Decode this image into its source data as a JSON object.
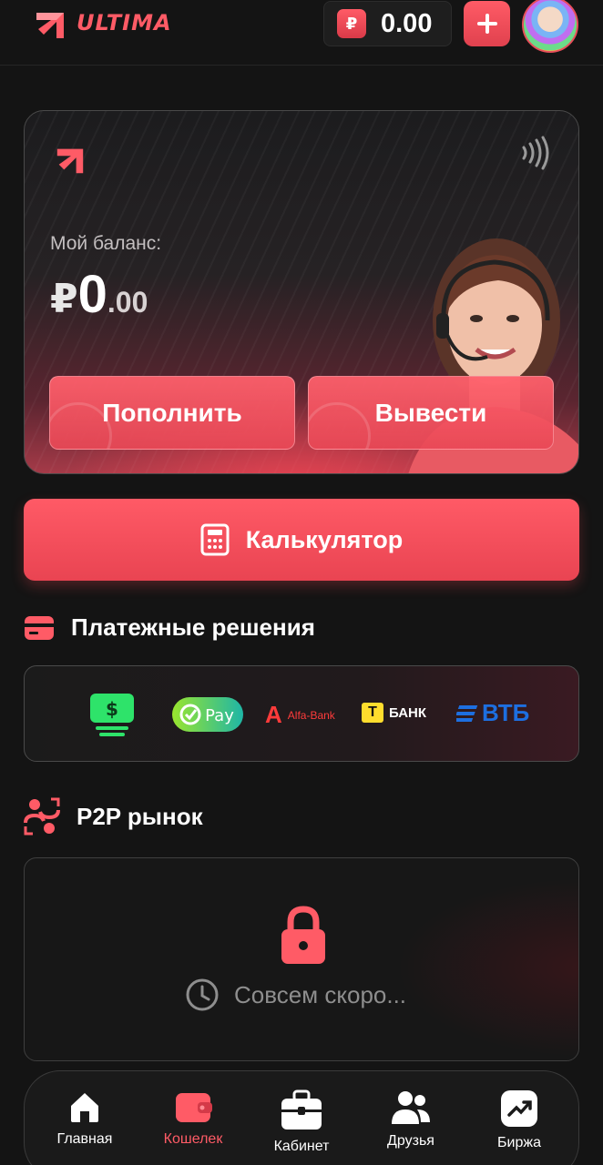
{
  "app": {
    "name": "ULTIMA"
  },
  "header": {
    "balance": "0.00",
    "currency_symbol": "₽"
  },
  "wallet_card": {
    "balance_label": "Мой баланс:",
    "balance_currency": "₽",
    "balance_integer": "0",
    "balance_decimal": ".00",
    "deposit_label": "Пополнить",
    "withdraw_label": "Вывести"
  },
  "calculator": {
    "label": "Калькулятор"
  },
  "payment_section": {
    "title": "Платежные решения",
    "providers": [
      {
        "name": "cash-icon",
        "label": "$"
      },
      {
        "name": "sberpay",
        "label": "Pay"
      },
      {
        "name": "alfa-bank",
        "label": "Alfa-Bank",
        "mark": "А"
      },
      {
        "name": "tbank",
        "label": "БАНК",
        "mark": "Т"
      },
      {
        "name": "vtb",
        "label": "ВТБ"
      }
    ]
  },
  "p2p_section": {
    "title": "P2P рынок",
    "status_text": "Совсем скоро..."
  },
  "bottom_nav": {
    "items": [
      {
        "label": "Главная",
        "icon": "home-icon",
        "active": false
      },
      {
        "label": "Кошелек",
        "icon": "wallet-icon",
        "active": true
      },
      {
        "label": "Кабинет",
        "icon": "briefcase-icon",
        "active": false
      },
      {
        "label": "Друзья",
        "icon": "users-icon",
        "active": false
      },
      {
        "label": "Биржа",
        "icon": "chart-up-icon",
        "active": false
      }
    ]
  },
  "colors": {
    "accent": "#ff5b66",
    "background": "#141414"
  }
}
